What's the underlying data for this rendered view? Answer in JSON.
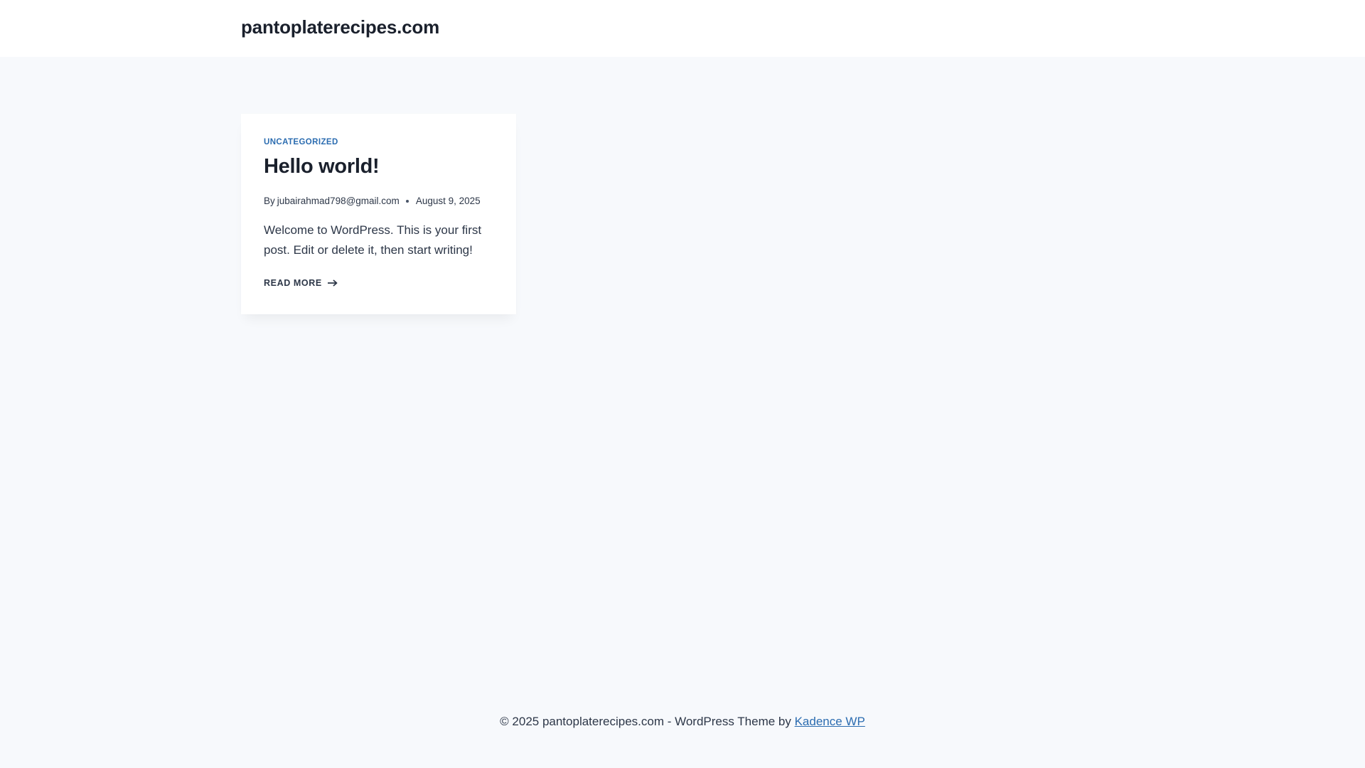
{
  "header": {
    "site_title": "pantoplaterecipes.com"
  },
  "post": {
    "category": "Uncategorized",
    "title": "Hello world!",
    "meta_by": "By",
    "author": "jubairahmad798@gmail.com",
    "date": "August 9, 2025",
    "excerpt": "Welcome to WordPress. This is your first post. Edit or delete it, then start writing!",
    "read_more_label": "Read More"
  },
  "footer": {
    "copyright_text": "© 2025 pantoplaterecipes.com - WordPress Theme by ",
    "theme_link_label": "Kadence WP"
  },
  "colors": {
    "background": "#f7f9fc",
    "accent": "#2b6cb0",
    "heading": "#1a202c",
    "text": "#2d3748"
  },
  "icons": {
    "read_more_arrow": "arrow-right-icon"
  }
}
